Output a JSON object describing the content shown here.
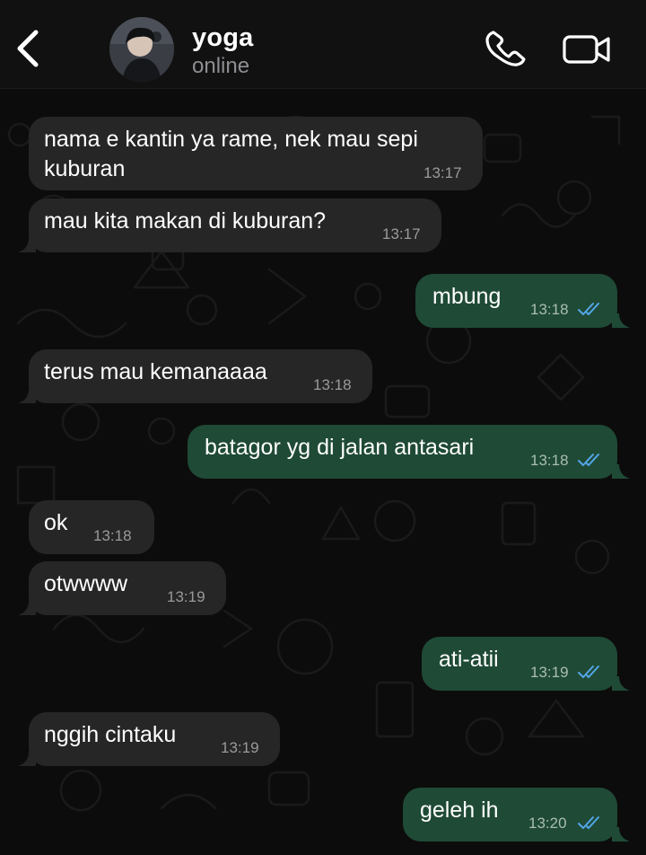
{
  "header": {
    "back_icon": "chevron-left-icon",
    "contact_name": "yoga",
    "contact_status": "online",
    "call_icon": "phone-icon",
    "video_icon": "video-camera-icon"
  },
  "colors": {
    "incoming_bubble": "#262626",
    "outgoing_bubble": "#1f4a36",
    "read_ticks": "#53a6e8",
    "background": "#0c0c0c"
  },
  "messages": [
    {
      "direction": "in",
      "text_lines": [
        "nama e kantin ya rame, nek mau sepi",
        "kuburan"
      ],
      "time": "13:17"
    },
    {
      "direction": "in",
      "text_lines": [
        "mau kita makan di kuburan?"
      ],
      "time": "13:17"
    },
    {
      "direction": "out",
      "text_lines": [
        "mbung"
      ],
      "time": "13:18",
      "status": "read"
    },
    {
      "direction": "in",
      "text_lines": [
        "terus mau kemanaaaa"
      ],
      "time": "13:18"
    },
    {
      "direction": "out",
      "text_lines": [
        "batagor yg di jalan antasari"
      ],
      "time": "13:18",
      "status": "read"
    },
    {
      "direction": "in",
      "text_lines": [
        "ok"
      ],
      "time": "13:18"
    },
    {
      "direction": "in",
      "text_lines": [
        "otwwww"
      ],
      "time": "13:19"
    },
    {
      "direction": "out",
      "text_lines": [
        "ati-atii"
      ],
      "time": "13:19",
      "status": "read"
    },
    {
      "direction": "in",
      "text_lines": [
        "nggih cintaku"
      ],
      "time": "13:19"
    },
    {
      "direction": "out",
      "text_lines": [
        "geleh ih"
      ],
      "time": "13:20",
      "status": "read"
    }
  ]
}
